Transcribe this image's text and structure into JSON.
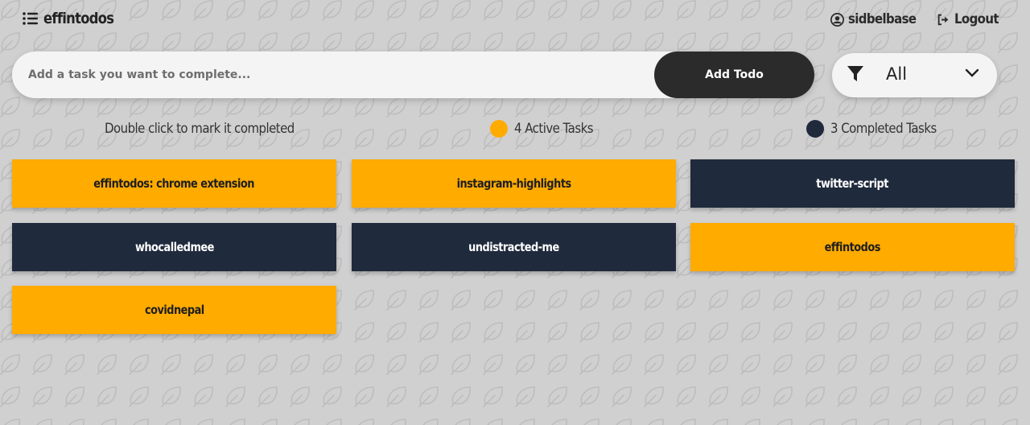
{
  "colors": {
    "active": "#ffab00",
    "completed": "#1f2a3c",
    "background": "#d0d0d0",
    "button": "#2b2b2b"
  },
  "header": {
    "app_name": "effintodos",
    "username": "sidbelbase",
    "logout_label": "Logout",
    "menu_icon": "list-icon",
    "user_icon": "user-circle-icon",
    "logout_icon": "sign-out-icon"
  },
  "form": {
    "placeholder": "Add a task you want to complete...",
    "add_label": "Add Todo"
  },
  "filter": {
    "value": "All",
    "icon": "filter-icon"
  },
  "info": {
    "hint": "Double click to mark it completed",
    "active_label": "4 Active Tasks",
    "completed_label": "3 Completed Tasks"
  },
  "tasks": [
    {
      "title": "effintodos: chrome extension",
      "status": "active"
    },
    {
      "title": "instagram-highlights",
      "status": "active"
    },
    {
      "title": "twitter-script",
      "status": "completed"
    },
    {
      "title": "whocalledmee",
      "status": "completed"
    },
    {
      "title": "undistracted-me",
      "status": "completed"
    },
    {
      "title": "effintodos",
      "status": "active"
    },
    {
      "title": "covidnepal",
      "status": "active"
    }
  ]
}
